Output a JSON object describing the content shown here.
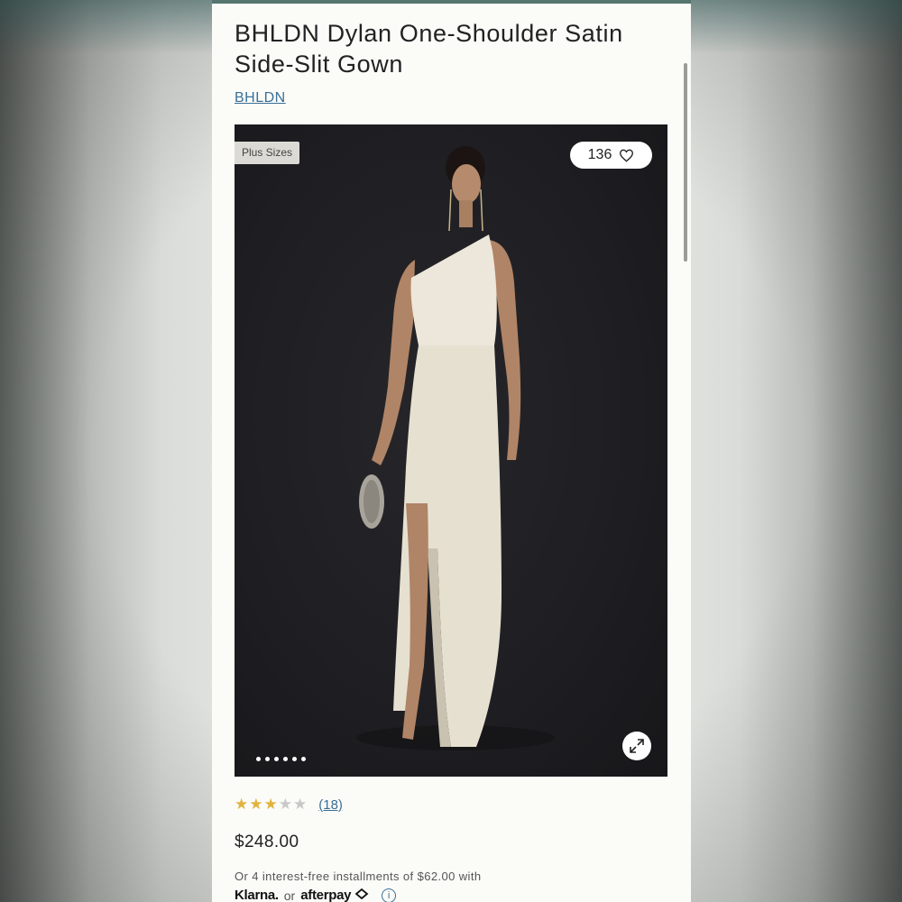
{
  "product": {
    "title": "BHLDN Dylan One-Shoulder Satin Side-Slit Gown",
    "brand_link": "BHLDN",
    "badge": "Plus Sizes",
    "likes": "136",
    "price": "$248.00",
    "installments_text": "Or 4 interest-free installments of $62.00 with"
  },
  "gallery": {
    "image_count": 6,
    "current_index": 0
  },
  "rating": {
    "stars": 3,
    "max_stars": 5,
    "review_count": "(18)"
  },
  "payment": {
    "klarna_label": "Klarna.",
    "or_label": "or",
    "afterpay_label": "afterpay"
  },
  "icons": {
    "heart": "heart-icon",
    "expand": "expand-icon",
    "info": "info-icon",
    "afterpay_logo": "afterpay-arrows-icon"
  },
  "colors": {
    "link": "#3a6f96",
    "star": "#e2b23c",
    "photo_bg": "#1f1f23",
    "dress": "#e9e4d6"
  }
}
